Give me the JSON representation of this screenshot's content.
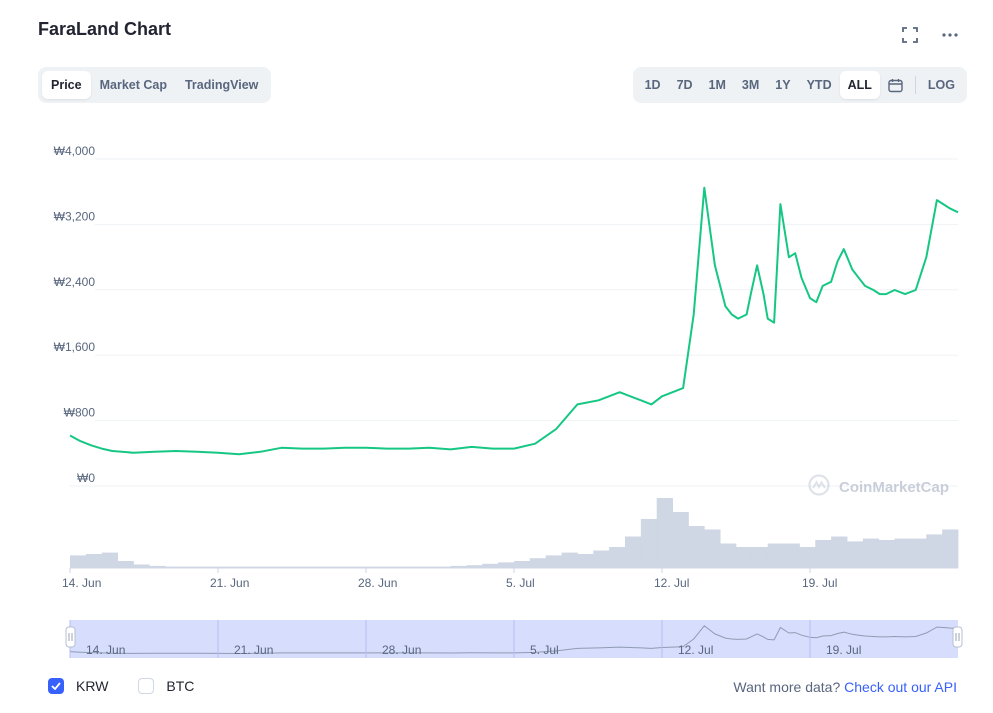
{
  "header": {
    "title": "FaraLand Chart"
  },
  "tabs": [
    {
      "label": "Price",
      "active": true
    },
    {
      "label": "Market Cap",
      "active": false
    },
    {
      "label": "TradingView",
      "active": false
    }
  ],
  "ranges": [
    {
      "label": "1D",
      "active": false
    },
    {
      "label": "7D",
      "active": false
    },
    {
      "label": "1M",
      "active": false
    },
    {
      "label": "3M",
      "active": false
    },
    {
      "label": "1Y",
      "active": false
    },
    {
      "label": "YTD",
      "active": false
    },
    {
      "label": "ALL",
      "active": true
    }
  ],
  "log_label": "LOG",
  "watermark": "CoinMarketCap",
  "footer": {
    "currencies": [
      {
        "label": "KRW",
        "checked": true
      },
      {
        "label": "BTC",
        "checked": false
      }
    ],
    "more_data_text": "Want more data?",
    "api_link": "Check out our API"
  },
  "colors": {
    "line": "#16c784",
    "accent": "#3861fb",
    "volume": "#cfd6e4",
    "navigator": "#c9d2fb"
  },
  "chart_data": {
    "type": "line",
    "ylabel": "",
    "xlabel": "",
    "y_ticks": [
      "₩0",
      "₩800",
      "₩1,600",
      "₩2,400",
      "₩3,200",
      "₩4,000"
    ],
    "y_tick_values": [
      0,
      800,
      1600,
      2400,
      3200,
      4000
    ],
    "ylim": [
      0,
      4000
    ],
    "x_ticks": [
      "14. Jun",
      "21. Jun",
      "28. Jun",
      "5. Jul",
      "12. Jul",
      "19. Jul"
    ],
    "x_tick_days": [
      0,
      7,
      14,
      21,
      28,
      35
    ],
    "xlim_days": [
      0,
      42
    ],
    "grid": true,
    "series": [
      {
        "values_x_days": [
          0,
          0.5,
          1,
          1.5,
          2,
          3,
          4,
          5,
          6,
          7,
          8,
          9,
          10,
          11,
          12,
          13,
          14,
          15,
          16,
          17,
          18,
          19,
          20,
          21,
          22,
          23,
          24,
          25,
          26,
          26.5,
          27,
          27.5,
          28,
          28.5,
          29,
          29.5,
          30,
          30.5,
          31,
          31.3,
          31.6,
          32,
          32.2,
          32.5,
          32.8,
          33,
          33.3,
          33.6,
          34,
          34.3,
          34.6,
          35,
          35.3,
          35.6,
          36,
          36.3,
          36.6,
          37,
          37.3,
          37.6,
          38,
          38.3,
          38.6,
          39,
          39.5,
          40,
          40.5,
          41,
          41.3,
          41.6,
          42
        ],
        "values_y": [
          520,
          450,
          400,
          360,
          330,
          310,
          320,
          330,
          320,
          310,
          290,
          320,
          370,
          360,
          360,
          370,
          370,
          360,
          360,
          370,
          350,
          380,
          360,
          360,
          420,
          600,
          900,
          950,
          1050,
          1000,
          950,
          900,
          1000,
          1050,
          1100,
          2000,
          3550,
          2600,
          2100,
          2000,
          1950,
          2000,
          2250,
          2600,
          2250,
          1950,
          1900,
          3350,
          2700,
          2750,
          2450,
          2200,
          2150,
          2350,
          2400,
          2650,
          2800,
          2550,
          2450,
          2350,
          2300,
          2250,
          2250,
          2300,
          2250,
          2300,
          2700,
          3400,
          3350,
          3300,
          3250
        ]
      }
    ],
    "volume_relative": [
      0.18,
      0.2,
      0.22,
      0.1,
      0.05,
      0.03,
      0.02,
      0.02,
      0.02,
      0.02,
      0.02,
      0.02,
      0.02,
      0.02,
      0.02,
      0.02,
      0.02,
      0.02,
      0.02,
      0.02,
      0.02,
      0.02,
      0.02,
      0.02,
      0.03,
      0.04,
      0.06,
      0.08,
      0.1,
      0.14,
      0.18,
      0.22,
      0.2,
      0.25,
      0.3,
      0.45,
      0.7,
      1.0,
      0.8,
      0.6,
      0.55,
      0.35,
      0.3,
      0.3,
      0.35,
      0.35,
      0.3,
      0.4,
      0.45,
      0.38,
      0.42,
      0.4,
      0.42,
      0.42,
      0.48,
      0.55
    ]
  }
}
